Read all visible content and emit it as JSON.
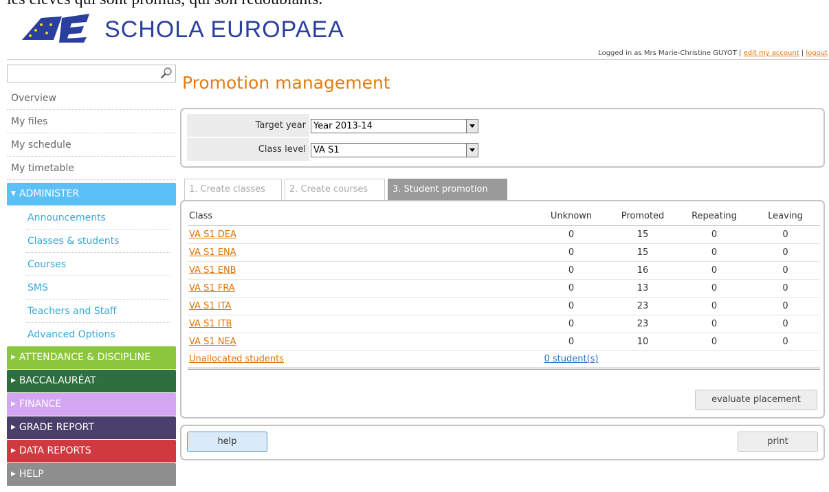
{
  "doc_line": "les élèves qui sont promus, qui son redoublants.",
  "logo": {
    "text": "SCHOLA EUROPAEA",
    "colors": {
      "blue": "#2a3f9e",
      "yellow": "#f2d21b"
    }
  },
  "header": {
    "logged_in_text": "Logged in as Mrs Marie-Christine GUYOT |",
    "edit_account": "edit my account",
    "separator": "|",
    "logout": "logout"
  },
  "sidebar": {
    "search_placeholder": "",
    "items": [
      {
        "label": "Overview"
      },
      {
        "label": "My files"
      },
      {
        "label": "My schedule"
      },
      {
        "label": "My timetable"
      }
    ],
    "administer": {
      "label": "ADMINISTER",
      "color": "#5bc0f8",
      "items": [
        {
          "label": "Announcements"
        },
        {
          "label": "Classes & students"
        },
        {
          "label": "Courses"
        },
        {
          "label": "SMS"
        },
        {
          "label": "Teachers and Staff"
        },
        {
          "label": "Advanced Options"
        }
      ]
    },
    "sections": [
      {
        "label": "ATTENDANCE & DISCIPLINE",
        "color": "#8cc63f"
      },
      {
        "label": "BACCALAURÉAT",
        "color": "#2e6f3e"
      },
      {
        "label": "FINANCE",
        "color": "#d4a6f2"
      },
      {
        "label": "GRADE REPORT",
        "color": "#4a3f6b"
      },
      {
        "label": "DATA REPORTS",
        "color": "#d0393f"
      },
      {
        "label": "HELP",
        "color": "#8e8e8e"
      }
    ]
  },
  "main": {
    "title": "Promotion management",
    "filters": {
      "target_year_label": "Target year",
      "target_year_value": "Year 2013-14",
      "class_level_label": "Class level",
      "class_level_value": "VA S1"
    },
    "tabs": [
      {
        "label": "1. Create classes",
        "active": false
      },
      {
        "label": "2. Create courses",
        "active": false
      },
      {
        "label": "3. Student promotion",
        "active": true
      }
    ],
    "table": {
      "columns": [
        "Class",
        "Unknown",
        "Promoted",
        "Repeating",
        "Leaving"
      ],
      "rows": [
        {
          "class": "VA S1 DEA",
          "unknown": "0",
          "promoted": "15",
          "repeating": "0",
          "leaving": "0"
        },
        {
          "class": "VA S1 ENA",
          "unknown": "0",
          "promoted": "15",
          "repeating": "0",
          "leaving": "0"
        },
        {
          "class": "VA S1 ENB",
          "unknown": "0",
          "promoted": "16",
          "repeating": "0",
          "leaving": "0"
        },
        {
          "class": "VA S1 FRA",
          "unknown": "0",
          "promoted": "13",
          "repeating": "0",
          "leaving": "0"
        },
        {
          "class": "VA S1 ITA",
          "unknown": "0",
          "promoted": "23",
          "repeating": "0",
          "leaving": "0"
        },
        {
          "class": "VA S1 ITB",
          "unknown": "0",
          "promoted": "23",
          "repeating": "0",
          "leaving": "0"
        },
        {
          "class": "VA S1 NEA",
          "unknown": "0",
          "promoted": "10",
          "repeating": "0",
          "leaving": "0"
        }
      ],
      "unallocated_label": "Unallocated students",
      "unallocated_count": "0 student(s)"
    },
    "evaluate_button": "evaluate placement",
    "help_button": "help",
    "print_button": "print"
  }
}
